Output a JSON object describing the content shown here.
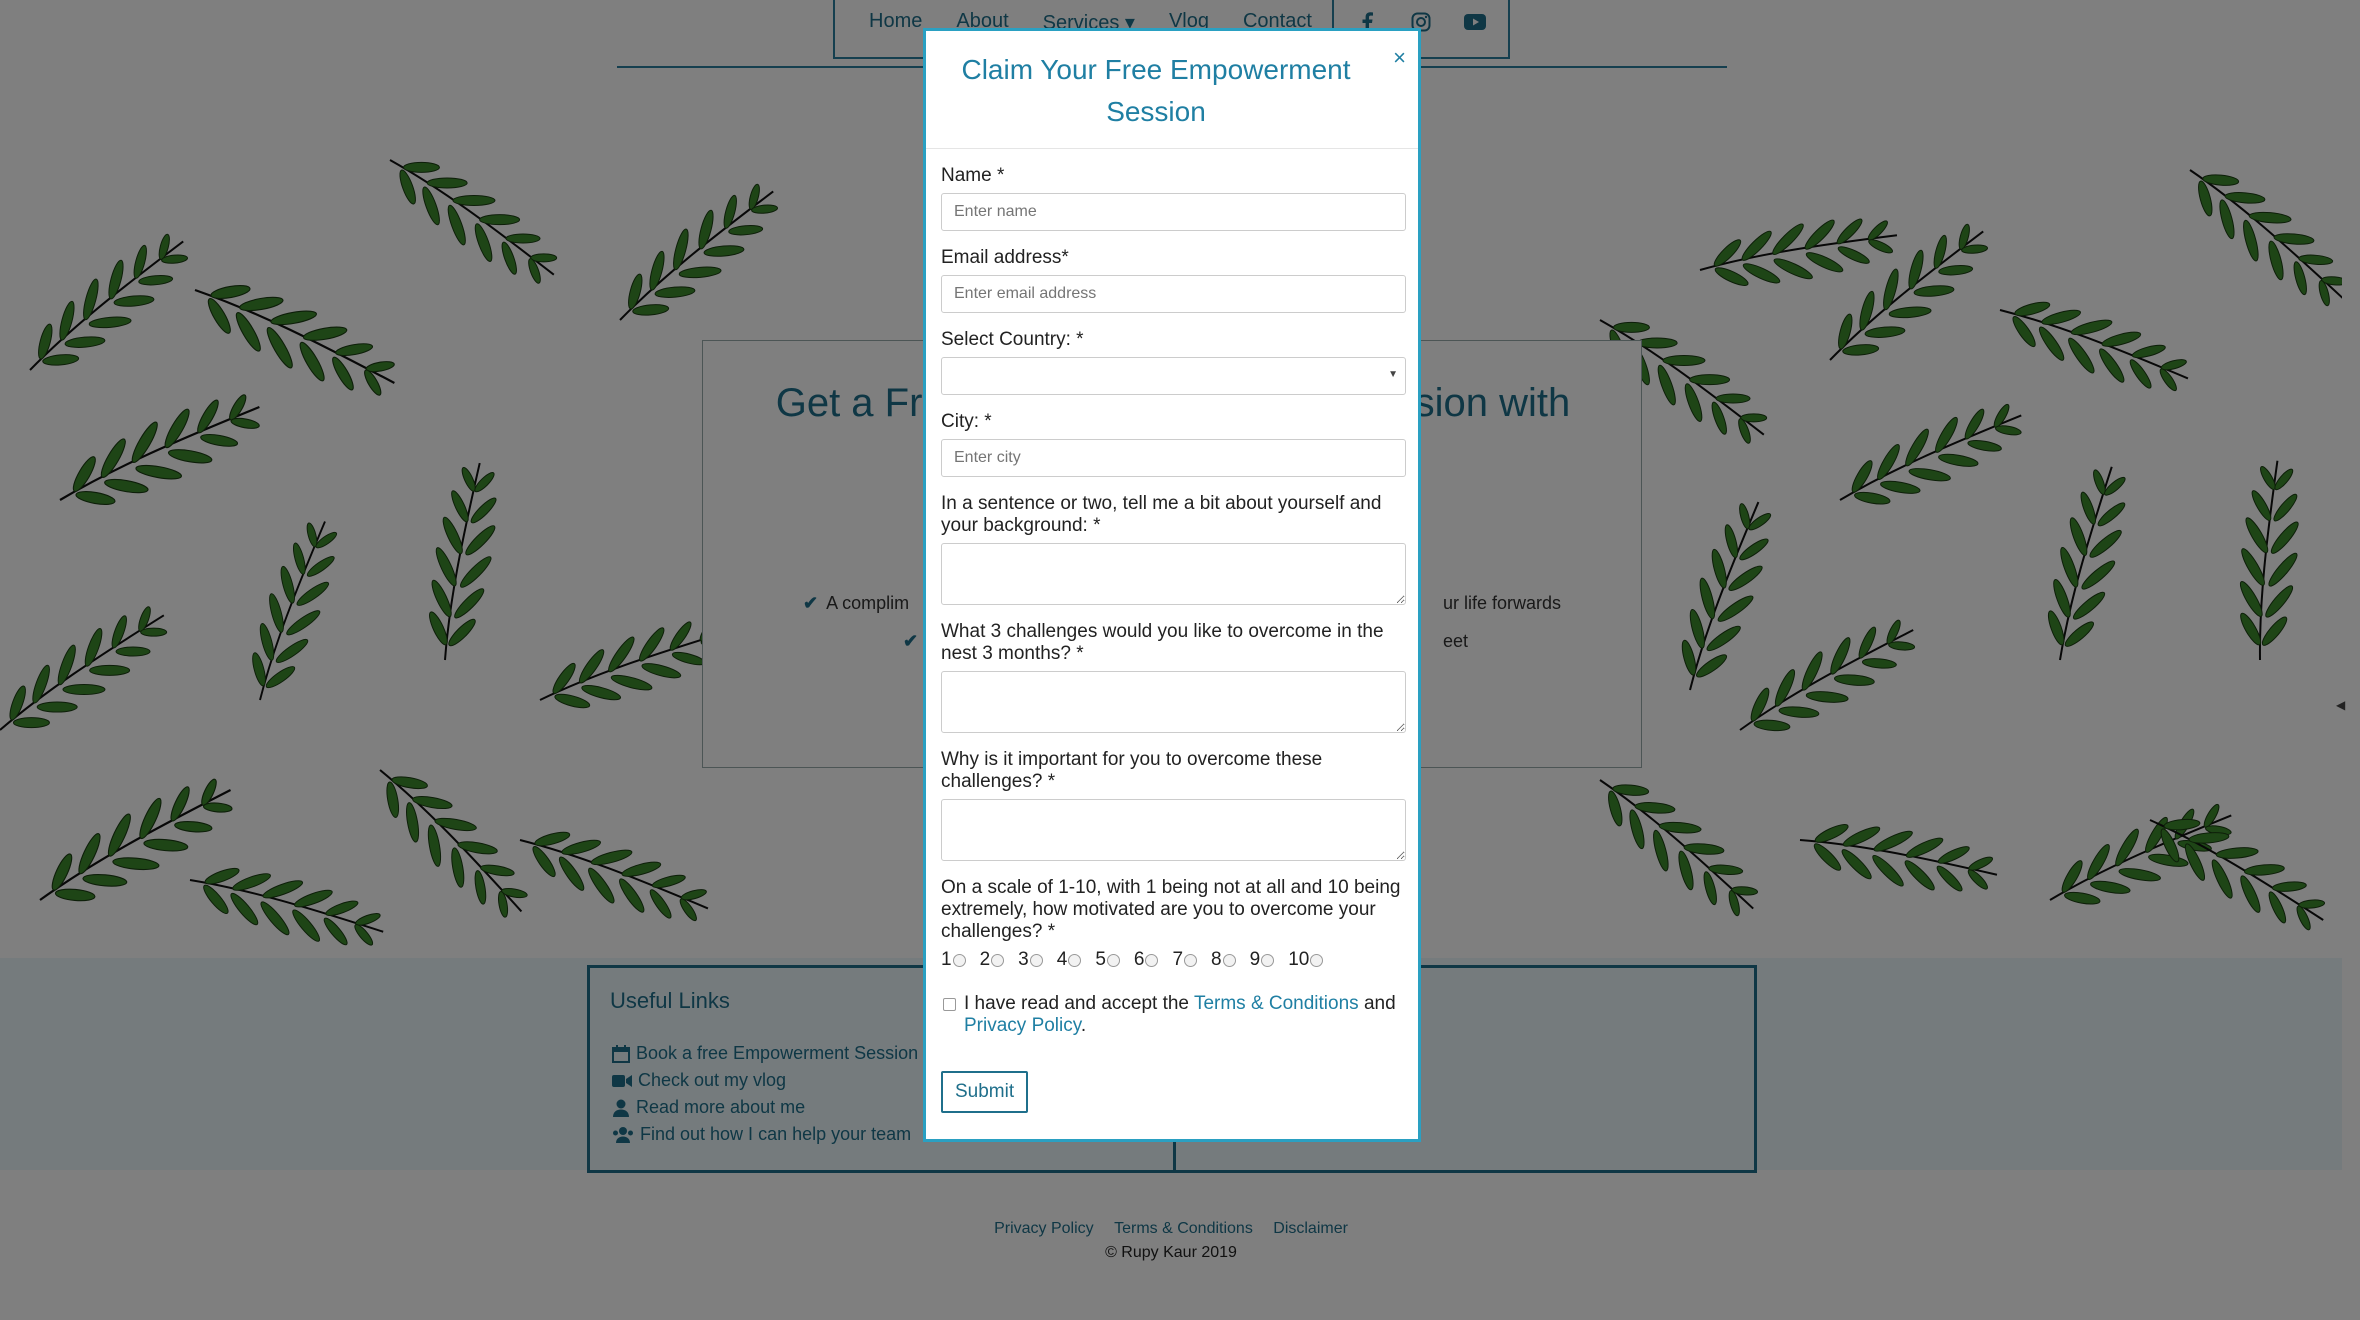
{
  "nav": {
    "links": [
      "Home",
      "About",
      "Services",
      "Vlog",
      "Contact"
    ],
    "services_caret": "▾",
    "social_icons": [
      "facebook-icon",
      "instagram-icon",
      "youtube-icon"
    ]
  },
  "hero": {
    "title_left": "Get a Fre",
    "title_right": "sion with",
    "bullet1_left": "A complim",
    "bullet1_right": "ur life forwards",
    "bullet2_right": "eet"
  },
  "useful_links": {
    "title": "Useful Links",
    "items": [
      {
        "icon": "calendar-icon",
        "label": "Book a free Empowerment Session"
      },
      {
        "icon": "video-camera-icon",
        "label": "Check out my vlog"
      },
      {
        "icon": "user-icon",
        "label": "Read more about me"
      },
      {
        "icon": "users-icon",
        "label": "Find out how I can help your team"
      }
    ]
  },
  "footer": {
    "links": [
      "Privacy Policy",
      "Terms & Conditions",
      "Disclaimer"
    ],
    "copyright": "© Rupy Kaur 2019"
  },
  "modal": {
    "title": "Claim Your Free Empowerment Session",
    "close": "×",
    "name_label": "Name *",
    "name_placeholder": "Enter name",
    "email_label": "Email address*",
    "email_placeholder": "Enter email address",
    "country_label": "Select Country: *",
    "country_value": "",
    "city_label": "City: *",
    "city_placeholder": "Enter city",
    "about_label": "In a sentence or two, tell me a bit about yourself and your background: *",
    "challenges_label": "What 3 challenges would you like to overcome in the nest 3 months? *",
    "why_label": "Why is it important for you to overcome these challenges? *",
    "scale_label": "On a scale of 1-10, with 1 being not at all and 10 being extremely, how motivated are you to overcome your challenges? *",
    "scale_options": [
      "1",
      "2",
      "3",
      "4",
      "5",
      "6",
      "7",
      "8",
      "9",
      "10"
    ],
    "accept_prefix": "I have read and accept the",
    "terms_link": "Terms & Conditions",
    "accept_and": "and",
    "privacy_link": "Privacy Policy",
    "accept_suffix": ".",
    "submit": "Submit"
  },
  "colors": {
    "accent": "#1f7fa3",
    "modal_border": "#2aa0c2",
    "overlay": "rgba(0,0,0,0.5)",
    "leaf_green": "#3d8a2c"
  }
}
